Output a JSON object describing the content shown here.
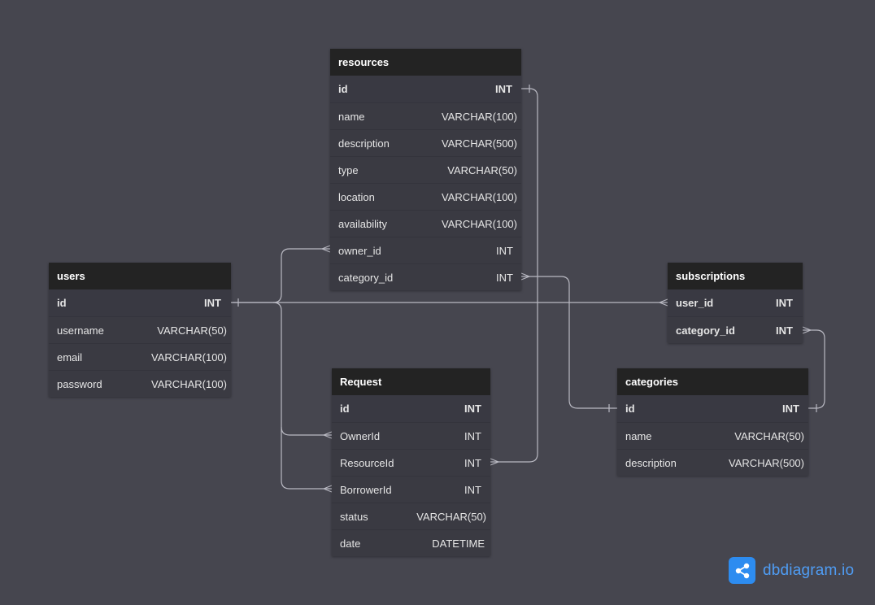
{
  "tables": {
    "resources": {
      "title": "resources",
      "columns": [
        {
          "name": "id",
          "type": "INT"
        },
        {
          "name": "name",
          "type": "VARCHAR(100)"
        },
        {
          "name": "description",
          "type": "VARCHAR(500)"
        },
        {
          "name": "type",
          "type": "VARCHAR(50)"
        },
        {
          "name": "location",
          "type": "VARCHAR(100)"
        },
        {
          "name": "availability",
          "type": "VARCHAR(100)"
        },
        {
          "name": "owner_id",
          "type": "INT"
        },
        {
          "name": "category_id",
          "type": "INT"
        }
      ]
    },
    "users": {
      "title": "users",
      "columns": [
        {
          "name": "id",
          "type": "INT"
        },
        {
          "name": "username",
          "type": "VARCHAR(50)"
        },
        {
          "name": "email",
          "type": "VARCHAR(100)"
        },
        {
          "name": "password",
          "type": "VARCHAR(100)"
        }
      ]
    },
    "subscriptions": {
      "title": "subscriptions",
      "columns": [
        {
          "name": "user_id",
          "type": "INT"
        },
        {
          "name": "category_id",
          "type": "INT"
        }
      ]
    },
    "request": {
      "title": "Request",
      "columns": [
        {
          "name": "id",
          "type": "INT"
        },
        {
          "name": "OwnerId",
          "type": "INT"
        },
        {
          "name": "ResourceId",
          "type": "INT"
        },
        {
          "name": "BorrowerId",
          "type": "INT"
        },
        {
          "name": "status",
          "type": "VARCHAR(50)"
        },
        {
          "name": "date",
          "type": "DATETIME"
        }
      ]
    },
    "categories": {
      "title": "categories",
      "columns": [
        {
          "name": "id",
          "type": "INT"
        },
        {
          "name": "name",
          "type": "VARCHAR(50)"
        },
        {
          "name": "description",
          "type": "VARCHAR(500)"
        }
      ]
    }
  },
  "relationships": [
    {
      "from": "users.id",
      "to": "resources.owner_id",
      "from_card": "one",
      "to_card": "many"
    },
    {
      "from": "users.id",
      "to": "subscriptions.user_id",
      "from_card": "one",
      "to_card": "many"
    },
    {
      "from": "users.id",
      "to": "Request.OwnerId",
      "from_card": "one",
      "to_card": "many"
    },
    {
      "from": "users.id",
      "to": "Request.BorrowerId",
      "from_card": "one",
      "to_card": "many"
    },
    {
      "from": "resources.id",
      "to": "Request.ResourceId",
      "from_card": "one",
      "to_card": "many"
    },
    {
      "from": "categories.id",
      "to": "resources.category_id",
      "from_card": "one",
      "to_card": "many"
    },
    {
      "from": "categories.id",
      "to": "subscriptions.category_id",
      "from_card": "one",
      "to_card": "many"
    }
  ],
  "colors": {
    "canvas_background": "#46464f",
    "table_header": "#232323",
    "table_body": "#3a3a42",
    "relationship_line": "#b9b9c2",
    "brand_blue": "#2d8cf0"
  },
  "brand": {
    "name_main": "dbdiagram",
    "name_suffix": ".io",
    "icon": "share-nodes-icon"
  }
}
